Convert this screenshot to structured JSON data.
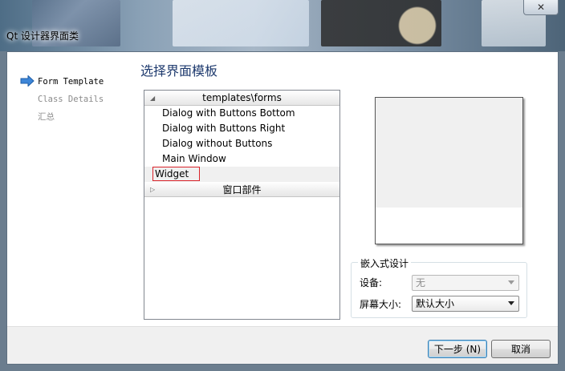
{
  "window": {
    "title": "Qt 设计器界面类",
    "close_symbol": "✕"
  },
  "nav": {
    "items": [
      {
        "label": "Form Template",
        "current": true
      },
      {
        "label": "Class Details",
        "current": false
      },
      {
        "label": "汇总",
        "current": false
      }
    ]
  },
  "page": {
    "title": "选择界面模板"
  },
  "tree": {
    "groups": [
      {
        "label": "templates\\forms",
        "toggle": "◢",
        "items": [
          "Dialog with Buttons Bottom",
          "Dialog with Buttons Right",
          "Dialog without Buttons",
          "Main Window",
          "Widget"
        ],
        "selected_index": 4
      },
      {
        "label": "窗口部件",
        "toggle": "▷",
        "items": []
      }
    ]
  },
  "embedded": {
    "title": "嵌入式设计",
    "device_label": "设备:",
    "device_value": "无",
    "screen_label": "屏幕大小:",
    "screen_value": "默认大小"
  },
  "buttons": {
    "next": "下一步 (N)",
    "cancel": "取消"
  },
  "colors": {
    "nav_arrow": "#3d86d8",
    "selection_outline": "#d9232a",
    "title_text": "#1e3a6e"
  }
}
